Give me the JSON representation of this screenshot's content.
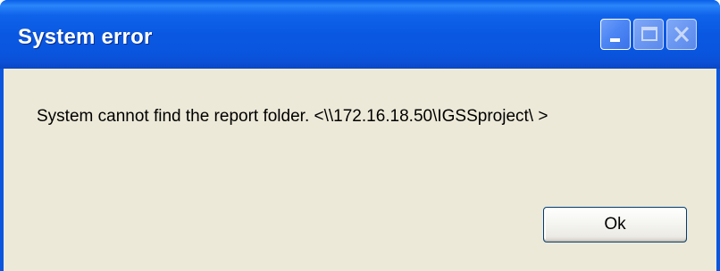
{
  "window": {
    "title": "System error",
    "controls": {
      "minimize": "minimize-icon",
      "maximize": "maximize-icon",
      "close": "close-icon"
    }
  },
  "dialog": {
    "message": "System cannot find the report folder. <\\\\172.16.18.50\\IGSSproject\\ >",
    "ok_label": "Ok"
  },
  "colors": {
    "titlebar": "#0a56df",
    "client_background": "#ece9d8",
    "button_border": "#003c74"
  }
}
